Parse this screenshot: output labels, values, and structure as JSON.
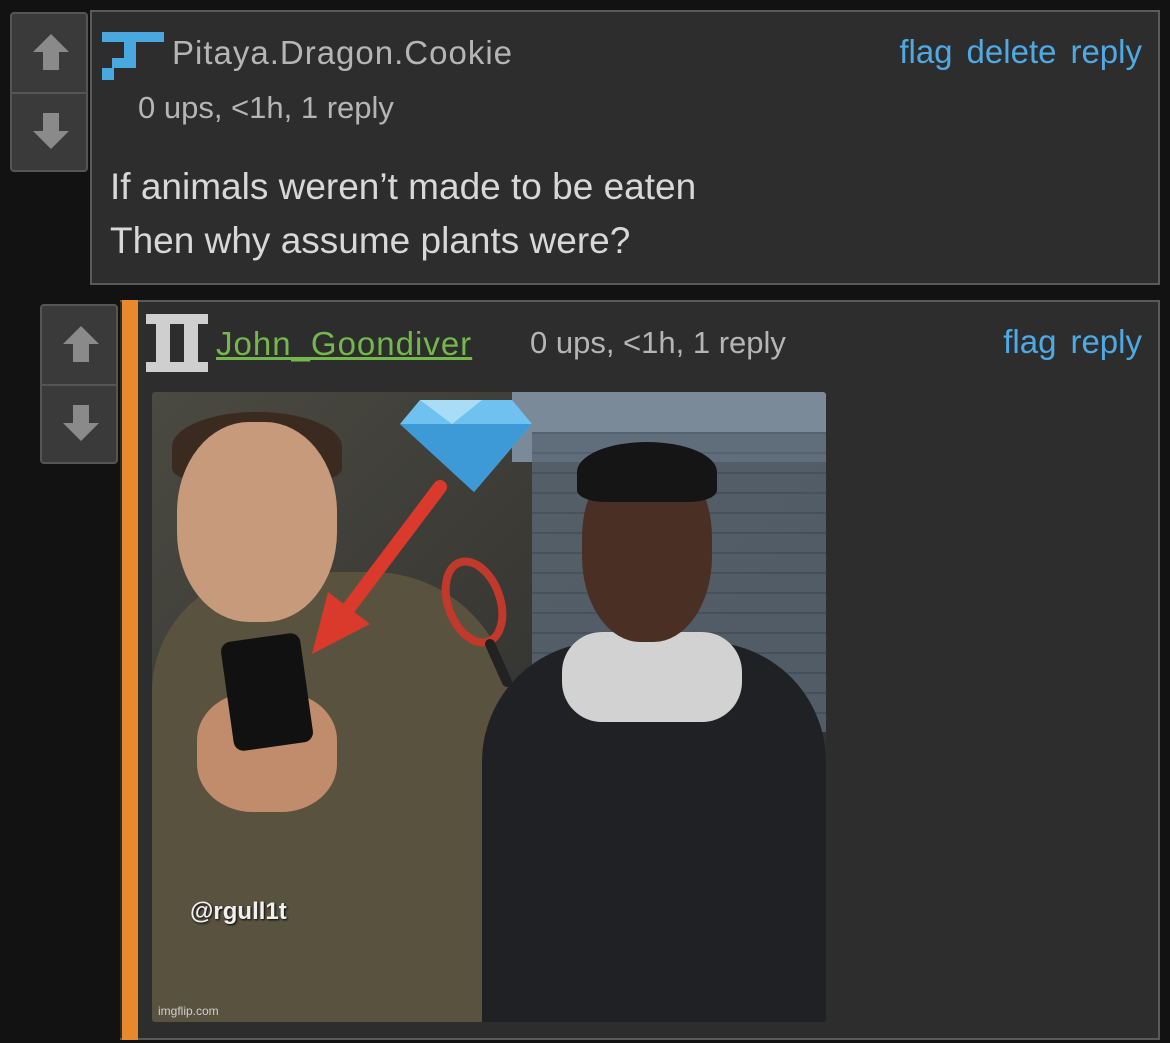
{
  "comment1": {
    "username": "Pitaya.Dragon.Cookie",
    "meta": "0 ups, <1h, 1 reply",
    "actions": {
      "flag": "flag",
      "delete": "delete",
      "reply": "reply"
    },
    "body_lines": [
      "If animals weren’t made to be eaten",
      "Then why assume plants were?"
    ],
    "user_icon": "pixel-badge-icon",
    "user_icon_color": "#4aa8e0"
  },
  "comment2": {
    "username": "John_Goondiver",
    "meta": "0 ups, <1h, 1 reply",
    "actions": {
      "flag": "flag",
      "reply": "reply"
    },
    "user_icon": "roman-two-badge-icon",
    "user_icon_color": "#cfcfcf",
    "accent_bar_color": "#e8892c",
    "image": {
      "watermark": "@rgull1t",
      "credit": "imgflip.com"
    }
  },
  "colors": {
    "link": "#4fa9e4",
    "username_green": "#72b84a",
    "text": "#d8d8d8",
    "meta": "#b5b5b5"
  }
}
